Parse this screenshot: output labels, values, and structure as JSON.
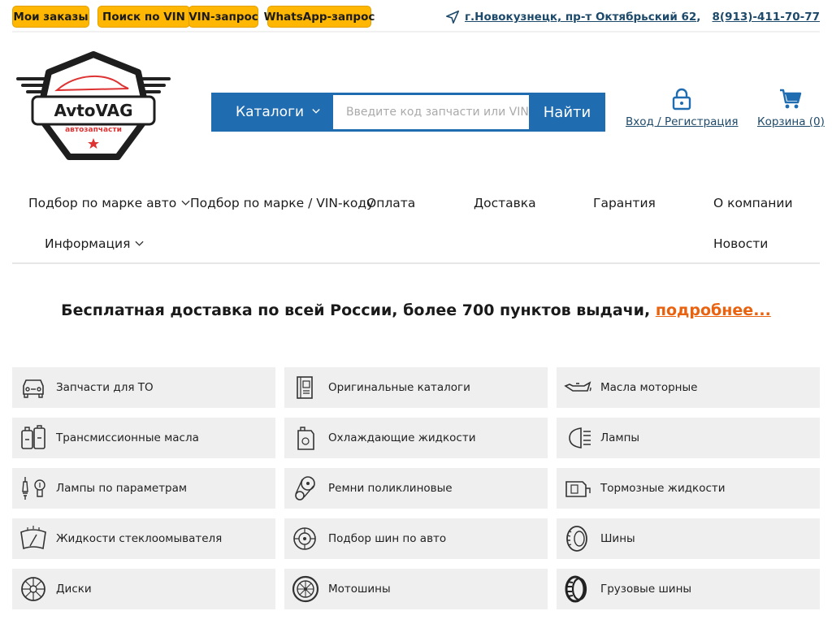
{
  "topbar": {
    "buttons": [
      {
        "label": "Мои заказы"
      },
      {
        "label": "Поиск по VIN"
      },
      {
        "label": "VIN-запрос"
      },
      {
        "label": "WhatsApp-запрос"
      }
    ],
    "address": "г.Новокузнецк, пр-т Октябрьский 62",
    "phone": "8(913)-411-70-77",
    "icon": "navigation-arrow-icon"
  },
  "logo": {
    "brand": "AvtoVAG",
    "subtitle": "автозапчасти"
  },
  "search": {
    "catalog_label": "Каталоги",
    "placeholder": "Введите код запчасти или VIN номер",
    "value": "",
    "submit_label": "Найти"
  },
  "account": {
    "login_label": "Вход / Регистрация",
    "cart_label": "Корзина (0)",
    "login_icon": "lock-icon",
    "cart_icon": "cart-icon"
  },
  "nav": {
    "items": [
      {
        "label": "Подбор по марке авто",
        "dropdown": true
      },
      {
        "label": "Подбор по марке / VIN-коду",
        "dropdown": false
      },
      {
        "label": "Оплата",
        "dropdown": false
      },
      {
        "label": "Доставка",
        "dropdown": false
      },
      {
        "label": "Гарантия",
        "dropdown": false
      },
      {
        "label": "О компании",
        "dropdown": false
      },
      {
        "label": "Информация",
        "dropdown": true
      },
      {
        "label": "Новости",
        "dropdown": false
      }
    ]
  },
  "promo": {
    "text": "Бесплатная доставка по всей России, более 700 пунктов выдачи, ",
    "link": "подробнее..."
  },
  "categories": [
    {
      "label": "Запчасти для ТО",
      "icon": "car-front-icon"
    },
    {
      "label": "Оригинальные каталоги",
      "icon": "catalog-book-icon"
    },
    {
      "label": "Масла моторные",
      "icon": "oil-can-icon"
    },
    {
      "label": "Трансмиссионные масла",
      "icon": "oil-bottles-icon"
    },
    {
      "label": "Охлаждающие жидкости",
      "icon": "coolant-canister-icon"
    },
    {
      "label": "Лампы",
      "icon": "headlight-icon"
    },
    {
      "label": "Лампы по параметрам",
      "icon": "bulbs-icon"
    },
    {
      "label": "Ремни поликлиновые",
      "icon": "belt-pulley-icon"
    },
    {
      "label": "Тормозные жидкости",
      "icon": "brake-fluid-icon"
    },
    {
      "label": "Жидкости стеклоомывателя",
      "icon": "windshield-washer-icon"
    },
    {
      "label": "Подбор шин по авто",
      "icon": "tire-search-icon"
    },
    {
      "label": "Шины",
      "icon": "tire-icon"
    },
    {
      "label": "Диски",
      "icon": "rim-icon"
    },
    {
      "label": "Мотошины",
      "icon": "moto-tire-icon"
    },
    {
      "label": "Грузовые шины",
      "icon": "truck-tire-icon"
    }
  ],
  "colors": {
    "accent_yellow": "#ffb703",
    "primary_blue": "#1f6cb1",
    "link_blue": "#1d4a6b",
    "promo_orange": "#e8620f",
    "tile_bg": "#efefef"
  }
}
